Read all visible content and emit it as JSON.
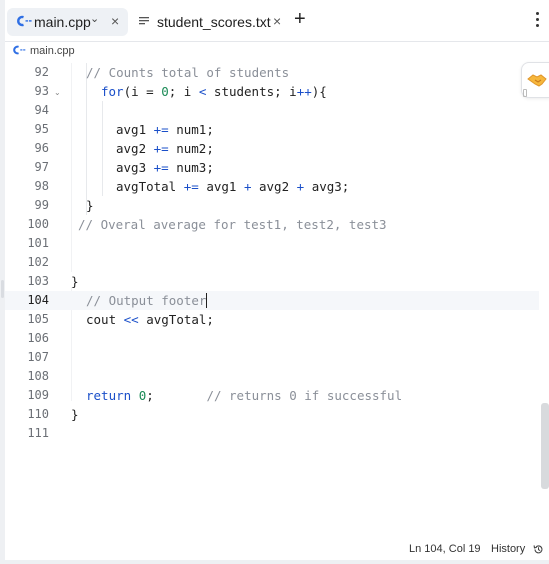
{
  "tabs": [
    {
      "label": "main.cpp",
      "icon": "cpp-logo-icon",
      "active": true
    },
    {
      "label": "student_scores.txt",
      "icon": "text-file-icon",
      "active": false
    }
  ],
  "tab_close_glyph": "×",
  "tab_chevron_glyph": "⌄",
  "add_tab_glyph": "+",
  "breadcrumb": {
    "file": "main.cpp"
  },
  "editor": {
    "current_line": 104,
    "lines": [
      {
        "n": "92",
        "tokens": [
          {
            "t": "// Counts total of students",
            "c": "cm"
          }
        ]
      },
      {
        "n": "93",
        "tokens": [
          {
            "t": "for",
            "c": "kw"
          },
          {
            "t": "(i = ",
            "c": "id"
          },
          {
            "t": "0",
            "c": "num"
          },
          {
            "t": "; i ",
            "c": "id"
          },
          {
            "t": "<",
            "c": "op"
          },
          {
            "t": " students; i",
            "c": "id"
          },
          {
            "t": "++",
            "c": "op"
          },
          {
            "t": "){",
            "c": "id"
          }
        ]
      },
      {
        "n": "94",
        "tokens": []
      },
      {
        "n": "95",
        "tokens": [
          {
            "t": "avg1 ",
            "c": "id"
          },
          {
            "t": "+=",
            "c": "op"
          },
          {
            "t": " num1;",
            "c": "id"
          }
        ]
      },
      {
        "n": "96",
        "tokens": [
          {
            "t": "avg2 ",
            "c": "id"
          },
          {
            "t": "+=",
            "c": "op"
          },
          {
            "t": " num2;",
            "c": "id"
          }
        ]
      },
      {
        "n": "97",
        "tokens": [
          {
            "t": "avg3 ",
            "c": "id"
          },
          {
            "t": "+=",
            "c": "op"
          },
          {
            "t": " num3;",
            "c": "id"
          }
        ]
      },
      {
        "n": "98",
        "tokens": [
          {
            "t": "avgTotal ",
            "c": "id"
          },
          {
            "t": "+=",
            "c": "op"
          },
          {
            "t": " avg1 ",
            "c": "id"
          },
          {
            "t": "+",
            "c": "op"
          },
          {
            "t": " avg2 ",
            "c": "id"
          },
          {
            "t": "+",
            "c": "op"
          },
          {
            "t": " avg3;",
            "c": "id"
          }
        ]
      },
      {
        "n": "99",
        "tokens": [
          {
            "t": "}",
            "c": "id"
          }
        ]
      },
      {
        "n": "100",
        "tokens": [
          {
            "t": "// Overal average for test1, test2, test3",
            "c": "cm"
          }
        ]
      },
      {
        "n": "101",
        "tokens": []
      },
      {
        "n": "102",
        "tokens": []
      },
      {
        "n": "103",
        "tokens": [
          {
            "t": "}",
            "c": "id"
          }
        ]
      },
      {
        "n": "104",
        "tokens": [
          {
            "t": "// Output footer",
            "c": "cm"
          }
        ]
      },
      {
        "n": "105",
        "tokens": [
          {
            "t": "cout ",
            "c": "id"
          },
          {
            "t": "<<",
            "c": "op"
          },
          {
            "t": " avgTotal;",
            "c": "id"
          }
        ]
      },
      {
        "n": "106",
        "tokens": []
      },
      {
        "n": "107",
        "tokens": []
      },
      {
        "n": "108",
        "tokens": []
      },
      {
        "n": "109",
        "tokens": [
          {
            "t": "return",
            "c": "kw"
          },
          {
            "t": " ",
            "c": "id"
          },
          {
            "t": "0",
            "c": "num"
          },
          {
            "t": ";       ",
            "c": "id"
          },
          {
            "t": "// returns 0 if successful",
            "c": "cm"
          }
        ]
      },
      {
        "n": "110",
        "tokens": [
          {
            "t": "}",
            "c": "id"
          }
        ]
      },
      {
        "n": "111",
        "tokens": []
      }
    ]
  },
  "status": {
    "position": "Ln 104, Col 19",
    "history": "History"
  },
  "colors": {
    "keyword": "#1a4fc9",
    "comment": "#8a8f98",
    "number": "#1a8a55",
    "cpp_logo": "#2f6fe4"
  }
}
